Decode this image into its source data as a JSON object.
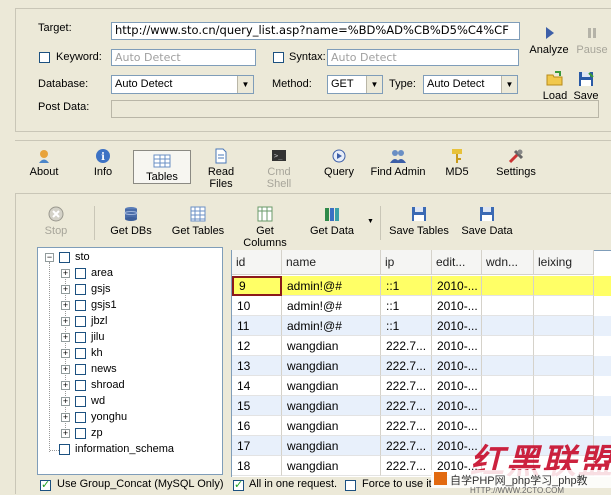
{
  "form": {
    "target_label": "Target:",
    "target_value": "http://www.sto.cn/query_list.asp?name=%BD%AD%CB%D5%C4%CF",
    "keyword_label": "Keyword:",
    "keyword_value": "Auto Detect",
    "syntax_label": "Syntax:",
    "syntax_value": "Auto Detect",
    "database_label": "Database:",
    "database_value": "Auto Detect",
    "method_label": "Method:",
    "method_value": "GET",
    "type_label": "Type:",
    "type_value": "Auto Detect",
    "postdata_label": "Post Data:",
    "postdata_value": ""
  },
  "side_buttons": {
    "analyze": "Analyze",
    "pause": "Pause",
    "load": "Load",
    "save": "Save"
  },
  "tabs": [
    {
      "label": "About",
      "icon": "about-icon"
    },
    {
      "label": "Info",
      "icon": "info-icon"
    },
    {
      "label": "Tables",
      "icon": "tables-icon"
    },
    {
      "label": "Read Files",
      "icon": "file-icon"
    },
    {
      "label": "Cmd Shell",
      "icon": "terminal-icon"
    },
    {
      "label": "Query",
      "icon": "query-icon"
    },
    {
      "label": "Find Admin",
      "icon": "admin-icon"
    },
    {
      "label": "MD5",
      "icon": "key-icon"
    },
    {
      "label": "Settings",
      "icon": "settings-icon"
    }
  ],
  "toolbar": {
    "stop": "Stop",
    "get_dbs": "Get DBs",
    "get_tables": "Get Tables",
    "get_columns": "Get Columns",
    "get_data": "Get Data",
    "save_tables": "Save Tables",
    "save_data": "Save Data"
  },
  "tree": {
    "root": "sto",
    "children": [
      "area",
      "gsjs",
      "gsjs1",
      "jbzl",
      "jilu",
      "kh",
      "news",
      "shroad",
      "wd",
      "yonghu",
      "zp"
    ],
    "sibling": "information_schema"
  },
  "grid": {
    "columns": [
      "id",
      "name",
      "ip",
      "edit...",
      "wdn...",
      "leixing"
    ],
    "rows": [
      [
        "9",
        "admin!@#",
        "::1",
        "2010-...",
        "",
        ""
      ],
      [
        "10",
        "admin!@#",
        "::1",
        "2010-...",
        "",
        ""
      ],
      [
        "11",
        "admin!@#",
        "::1",
        "2010-...",
        "",
        ""
      ],
      [
        "12",
        "wangdian",
        "222.7...",
        "2010-...",
        "",
        ""
      ],
      [
        "13",
        "wangdian",
        "222.7...",
        "2010-...",
        "",
        ""
      ],
      [
        "14",
        "wangdian",
        "222.7...",
        "2010-...",
        "",
        ""
      ],
      [
        "15",
        "wangdian",
        "222.7...",
        "2010-...",
        "",
        ""
      ],
      [
        "16",
        "wangdian",
        "222.7...",
        "2010-...",
        "",
        ""
      ],
      [
        "17",
        "wangdian",
        "222.7...",
        "2010-...",
        "",
        ""
      ],
      [
        "18",
        "wangdian",
        "222.7...",
        "2010-...",
        "",
        ""
      ]
    ]
  },
  "footer": {
    "group_concat": "Use Group_Concat (MySQL Only)",
    "one_request": "All in one request.",
    "force": "Force to use it",
    "watermark_text": "自学PHP网_php学习_php教",
    "watermark_logo": "红黑联盟",
    "watermark_url": "HTTP://WWW.2CTO.COM"
  },
  "colors": {
    "selected_row": "#ffff66",
    "alt_row": "#e8f0fb",
    "accent": "#316ac5"
  }
}
